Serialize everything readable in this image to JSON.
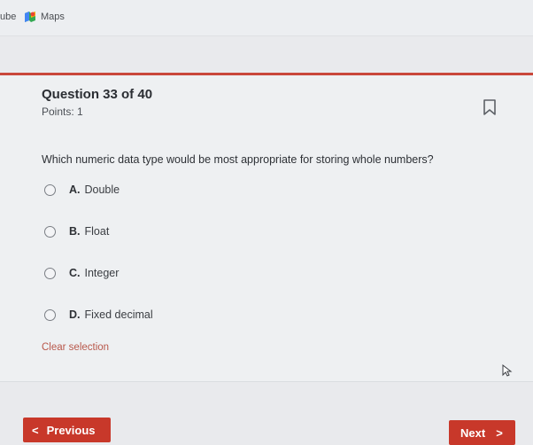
{
  "bookmarks": {
    "partial_label": "ube",
    "maps_label": "Maps"
  },
  "question": {
    "title": "Question 33 of 40",
    "points": "Points: 1",
    "text": "Which numeric data type would be most appropriate for storing whole numbers?"
  },
  "options": [
    {
      "letter": "A.",
      "text": "Double"
    },
    {
      "letter": "B.",
      "text": "Float"
    },
    {
      "letter": "C.",
      "text": "Integer"
    },
    {
      "letter": "D.",
      "text": "Fixed decimal"
    }
  ],
  "clear_selection": "Clear selection",
  "nav": {
    "previous_label": "Previous",
    "next_label": "Next",
    "previous_chevron": "<",
    "next_chevron": ">"
  },
  "colors": {
    "accent": "#c8382a",
    "link": "#b8574a"
  }
}
